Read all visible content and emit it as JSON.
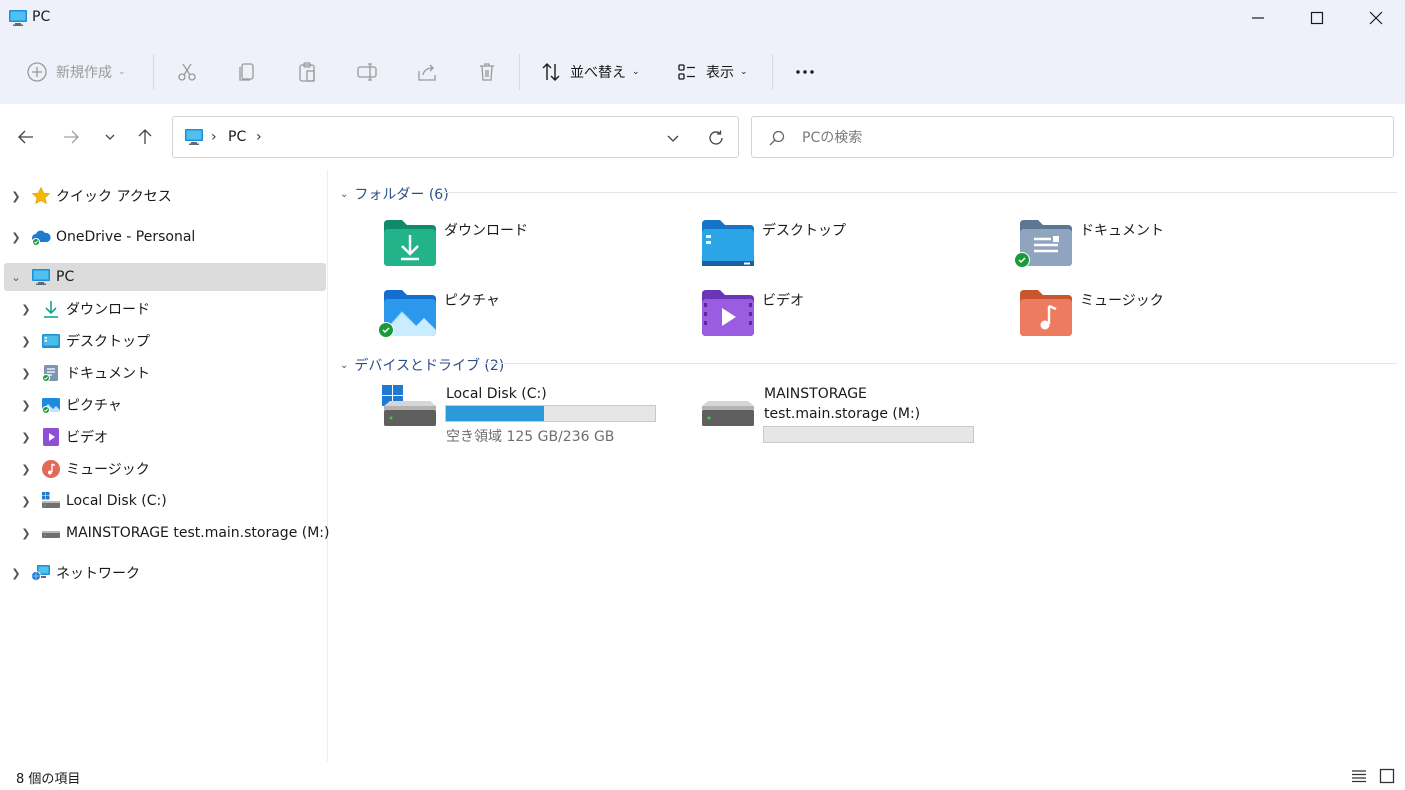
{
  "window": {
    "title": "PC"
  },
  "toolbar": {
    "new_label": "新規作成",
    "sort_label": "並べ替え",
    "view_label": "表示"
  },
  "address": {
    "path": [
      "PC"
    ]
  },
  "search": {
    "placeholder": "PCの検索"
  },
  "sidebar": {
    "items": [
      {
        "label": "クイック アクセス",
        "icon": "star-icon",
        "level": 0,
        "selected": false
      },
      {
        "label": "OneDrive - Personal",
        "icon": "cloud-icon",
        "level": 0,
        "selected": false
      },
      {
        "label": "PC",
        "icon": "pc-icon",
        "level": 0,
        "selected": true,
        "expanded": true
      },
      {
        "label": "ダウンロード",
        "icon": "download-icon",
        "level": 1
      },
      {
        "label": "デスクトップ",
        "icon": "desktop-icon",
        "level": 1
      },
      {
        "label": "ドキュメント",
        "icon": "documents-icon",
        "level": 1
      },
      {
        "label": "ピクチャ",
        "icon": "pictures-icon",
        "level": 1
      },
      {
        "label": "ビデオ",
        "icon": "videos-icon",
        "level": 1
      },
      {
        "label": "ミュージック",
        "icon": "music-icon",
        "level": 1
      },
      {
        "label": "Local Disk (C:)",
        "icon": "windows-drive-icon",
        "level": 1
      },
      {
        "label": "MAINSTORAGE test.main.storage (M:)",
        "icon": "drive-icon",
        "level": 1
      },
      {
        "label": "ネットワーク",
        "icon": "network-icon",
        "level": 0
      }
    ]
  },
  "main": {
    "folders_group": "フォルダー (6)",
    "folders": [
      {
        "label": "ダウンロード",
        "icon": "download-folder-icon",
        "synced": false
      },
      {
        "label": "デスクトップ",
        "icon": "desktop-folder-icon",
        "synced": false
      },
      {
        "label": "ドキュメント",
        "icon": "documents-folder-icon",
        "synced": true
      },
      {
        "label": "ピクチャ",
        "icon": "pictures-folder-icon",
        "synced": true
      },
      {
        "label": "ビデオ",
        "icon": "videos-folder-icon",
        "synced": false
      },
      {
        "label": "ミュージック",
        "icon": "music-folder-icon",
        "synced": false
      }
    ],
    "drives_group": "デバイスとドライブ (2)",
    "drives": [
      {
        "name_line1": "Local Disk (C:)",
        "name_line2": "",
        "free_text": "空き領域 125 GB/236 GB",
        "used_fraction": 0.47
      },
      {
        "name_line1": "MAINSTORAGE",
        "name_line2": "test.main.storage (M:)",
        "free_text": "",
        "used_fraction": 0.0
      }
    ]
  },
  "status": {
    "item_count": "8 個の項目"
  },
  "colors": {
    "accent": "#2a9ad8",
    "selected_bg": "#dcdcdc",
    "ribbon_bg": "#eef1f9",
    "group_text": "#2b4f8a"
  }
}
